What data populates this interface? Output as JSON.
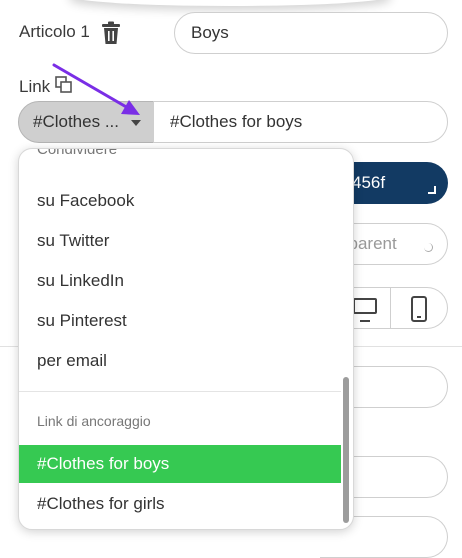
{
  "form": {
    "article_label": "Articolo 1",
    "article_value": "Boys",
    "link_label": "Link",
    "link_type_label": "#Clothes ...",
    "link_value": "#Clothes for boys",
    "color_value": "456f",
    "transparency_placeholder": "sparent"
  },
  "dropdown": {
    "header_clipped": "Condividere",
    "items": [
      {
        "label": "su Facebook"
      },
      {
        "label": "su Twitter"
      },
      {
        "label": "su LinkedIn"
      },
      {
        "label": "su Pinterest"
      },
      {
        "label": "per email"
      }
    ],
    "group_label": "Link di ancoraggio",
    "anchor_items": [
      {
        "label": "#Clothes for boys",
        "selected": true
      },
      {
        "label": "#Clothes for girls",
        "selected": false
      }
    ]
  },
  "icons": {
    "trash": "trash-icon",
    "link": "duplicate-link-icon",
    "caret": "caret-down-icon",
    "desktop": "desktop-icon",
    "mobile": "mobile-icon"
  },
  "colors": {
    "selected": "#36c952",
    "navy": "#123a63",
    "annotation_arrow": "#7a2ee6"
  }
}
